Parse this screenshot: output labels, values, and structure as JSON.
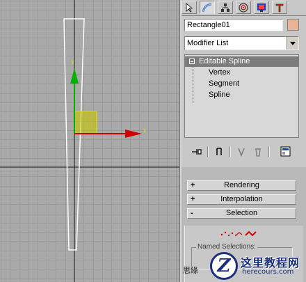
{
  "viewport": {
    "axis_x_label": "x",
    "axis_y_label": "y"
  },
  "panel": {
    "tabs": [
      "create-icon",
      "modify-icon",
      "hierarchy-icon",
      "motion-icon",
      "display-icon",
      "utilities-icon"
    ],
    "object_name": "Rectangle01",
    "object_color": "#e9b398",
    "modifier_list_label": "Modifier List",
    "stack": {
      "top": "Editable Spline",
      "subs": [
        "Vertex",
        "Segment",
        "Spline"
      ]
    },
    "rollouts": [
      {
        "sign": "+",
        "label": "Rendering"
      },
      {
        "sign": "+",
        "label": "Interpolation"
      },
      {
        "sign": "-",
        "label": "Selection"
      }
    ],
    "named_selections_label": "Named Selections:",
    "truncated_text": "思缘"
  },
  "watermark": {
    "logo_letter": "Z",
    "title": "这里教程网",
    "url": "herecours.com"
  },
  "colors": {
    "viewport_bg": "#a9a9a9",
    "grid": "#9a9a9a",
    "axis_x": "#cc0000",
    "axis_y": "#00a000",
    "gizmo_plane": "#d8d800",
    "spline": "#ffffff"
  }
}
